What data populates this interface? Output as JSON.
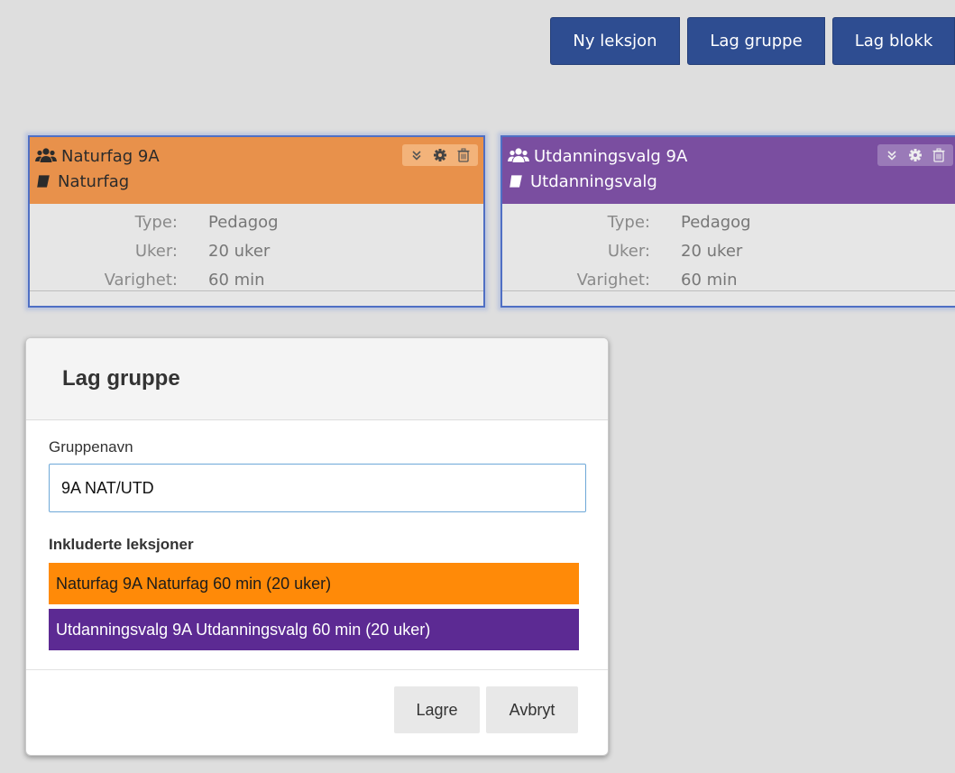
{
  "toolbar": {
    "new_lesson": "Ny leksjon",
    "make_group": "Lag gruppe",
    "make_block": "Lag blokk"
  },
  "cards": [
    {
      "title": "Naturfag 9A",
      "subject": "Naturfag",
      "type_label": "Type:",
      "type_value": "Pedagog",
      "weeks_label": "Uker:",
      "weeks_value": "20 uker",
      "duration_label": "Varighet:",
      "duration_value": "60 min",
      "color": "#e8914b"
    },
    {
      "title": "Utdanningsvalg 9A",
      "subject": "Utdanningsvalg",
      "type_label": "Type:",
      "type_value": "Pedagog",
      "weeks_label": "Uker:",
      "weeks_value": "20 uker",
      "duration_label": "Varighet:",
      "duration_value": "60 min",
      "color": "#7a4ea0"
    }
  ],
  "icons": {
    "group": "users-icon",
    "subject": "book-icon",
    "expand": "chevron-double-down-icon",
    "settings": "gear-icon",
    "delete": "trash-icon"
  },
  "modal": {
    "title": "Lag gruppe",
    "group_name_label": "Gruppenavn",
    "group_name_value": "9A NAT/UTD",
    "included_label": "Inkluderte leksjoner",
    "lessons": [
      {
        "text": "Naturfag 9A Naturfag 60 min (20 uker)",
        "color": "#ff8a08"
      },
      {
        "text": "Utdanningsvalg 9A Utdanningsvalg 60 min (20 uker)",
        "color": "#5c2a93"
      }
    ],
    "save_label": "Lagre",
    "cancel_label": "Avbryt"
  },
  "colors": {
    "primary_button": "#2e4d91",
    "background": "#dedede",
    "card_border": "#4f6fc4"
  }
}
